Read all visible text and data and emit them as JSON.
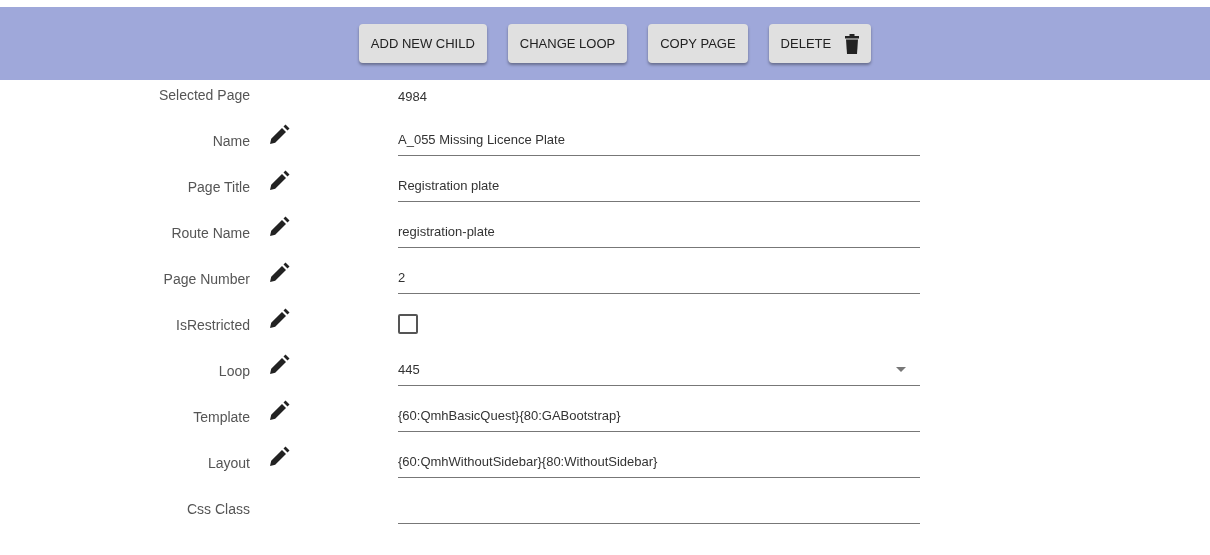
{
  "toolbar": {
    "buttons": [
      {
        "label": "ADD NEW CHILD",
        "kind": "text"
      },
      {
        "label": "CHANGE LOOP",
        "kind": "text"
      },
      {
        "label": "COPY PAGE",
        "kind": "text"
      },
      {
        "label": "DELETE",
        "kind": "trash"
      }
    ]
  },
  "fields": [
    {
      "label": "Selected Page",
      "kind": "static",
      "editable": false,
      "value": "4984"
    },
    {
      "label": "Name",
      "kind": "text",
      "editable": true,
      "value": "A_055 Missing Licence Plate"
    },
    {
      "label": "Page Title",
      "kind": "text",
      "editable": true,
      "value": "Registration plate"
    },
    {
      "label": "Route Name",
      "kind": "text",
      "editable": true,
      "value": "registration-plate"
    },
    {
      "label": "Page Number",
      "kind": "text",
      "editable": true,
      "value": "2"
    },
    {
      "label": "IsRestricted",
      "kind": "checkbox",
      "editable": true,
      "checked": false
    },
    {
      "label": "Loop",
      "kind": "select",
      "editable": true,
      "value": "445"
    },
    {
      "label": "Template",
      "kind": "text",
      "editable": true,
      "value": "{60:QmhBasicQuest}{80:GABootstrap}"
    },
    {
      "label": "Layout",
      "kind": "text",
      "editable": true,
      "value": "{60:QmhWithoutSidebar}{80:WithoutSidebar}"
    },
    {
      "label": "Css Class",
      "kind": "text",
      "editable": false
    }
  ]
}
